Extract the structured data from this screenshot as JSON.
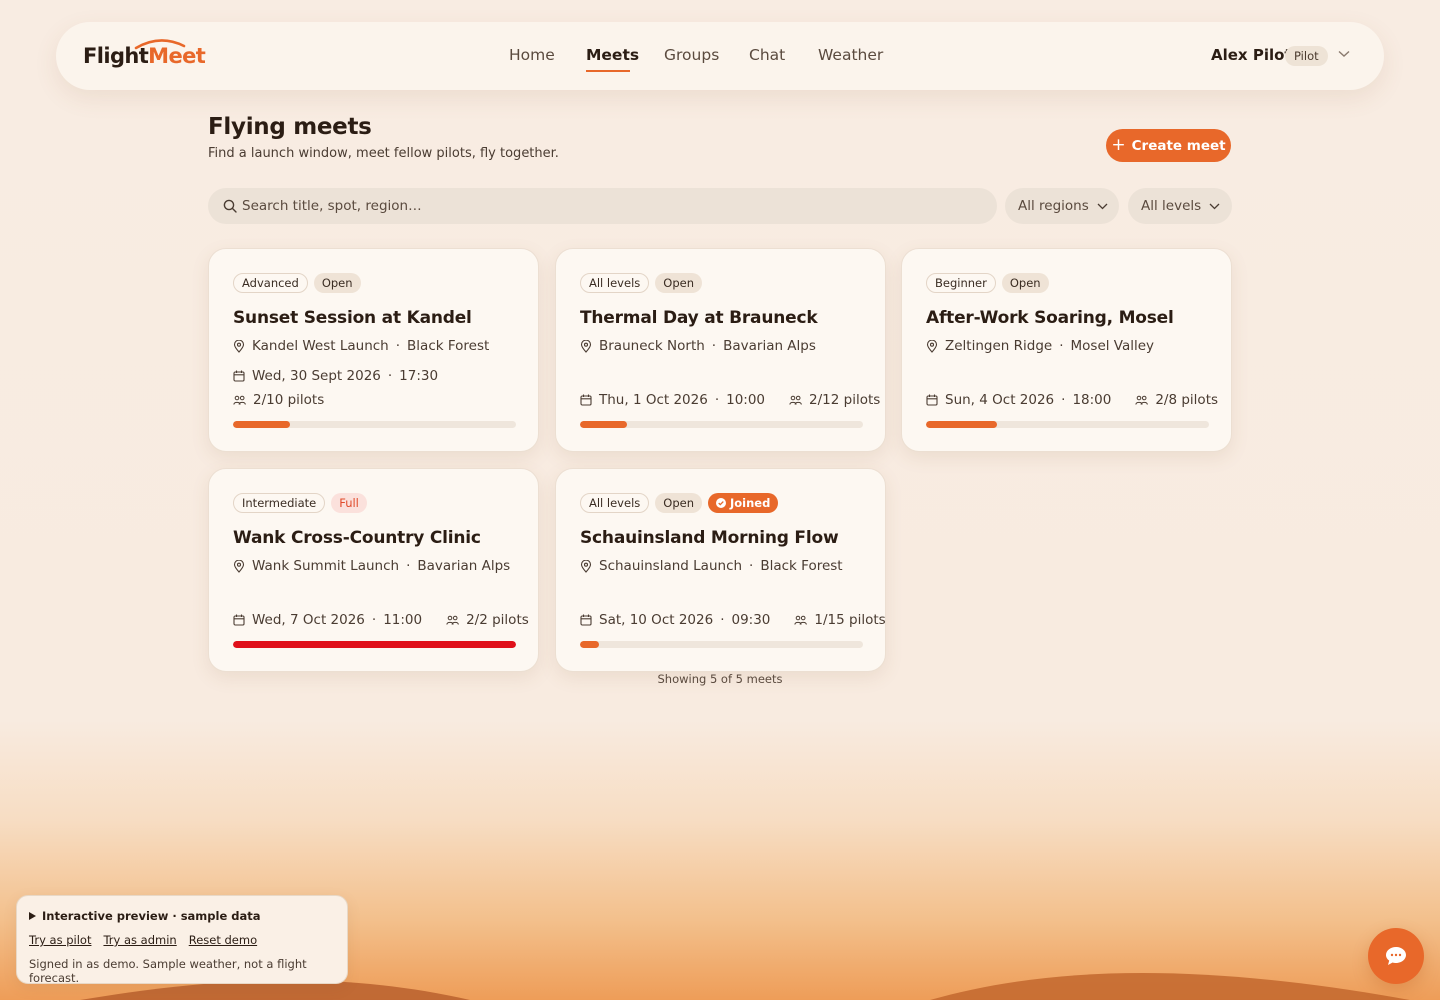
{
  "brand": {
    "part1": "Flight",
    "part2": "Meet",
    "accent": "#e8682a"
  },
  "nav": {
    "items": [
      "Home",
      "Meets",
      "Groups",
      "Chat",
      "Weather"
    ],
    "active": "Meets"
  },
  "user": {
    "name": "Alex Pilot",
    "role": "Pilot"
  },
  "page": {
    "title": "Flying meets",
    "subtitle": "Find a launch window, meet fellow pilots, fly together.",
    "create_label": "Create meet"
  },
  "filters": {
    "search_placeholder": "Search title, spot, region…",
    "region": "All regions",
    "level": "All levels"
  },
  "meets": [
    {
      "level": "Advanced",
      "status": "Open",
      "joined": "",
      "title": "Sunset Session at Kandel",
      "spot": "Kandel West Launch",
      "region": "Black Forest",
      "date": "Wed, 30 Sept 2026",
      "time": "17:30",
      "pilots": "2/10 pilots",
      "fill": 0.2
    },
    {
      "level": "All levels",
      "status": "Open",
      "joined": "",
      "title": "Thermal Day at Brauneck",
      "spot": "Brauneck North",
      "region": "Bavarian Alps",
      "date": "Thu, 1 Oct 2026",
      "time": "10:00",
      "pilots": "2/12 pilots",
      "fill": 0.167
    },
    {
      "level": "Beginner",
      "status": "Open",
      "joined": "",
      "title": "After-Work Soaring, Mosel",
      "spot": "Zeltingen Ridge",
      "region": "Mosel Valley",
      "date": "Sun, 4 Oct 2026",
      "time": "18:00",
      "pilots": "2/8 pilots",
      "fill": 0.25
    },
    {
      "level": "Intermediate",
      "status": "Full",
      "joined": "",
      "title": "Wank Cross-Country Clinic",
      "spot": "Wank Summit Launch",
      "region": "Bavarian Alps",
      "date": "Wed, 7 Oct 2026",
      "time": "11:00",
      "pilots": "2/2 pilots",
      "fill": 1.0
    },
    {
      "level": "All levels",
      "status": "Open",
      "joined": "Joined",
      "title": "Schauinsland Morning Flow",
      "spot": "Schauinsland Launch",
      "region": "Black Forest",
      "date": "Sat, 10 Oct 2026",
      "time": "09:30",
      "pilots": "1/15 pilots",
      "fill": 0.067
    }
  ],
  "showing": "Showing 5 of 5 meets",
  "demo": {
    "title": "Interactive preview · sample data",
    "links": [
      "Try as pilot",
      "Try as admin",
      "Reset demo"
    ],
    "note": "Signed in as demo. Sample weather, not a flight forecast."
  },
  "icons": {
    "search": "search-icon",
    "pin": "map-pin-icon",
    "calendar": "calendar-icon",
    "pilots": "users-icon",
    "chat": "chat-bubble-icon"
  }
}
